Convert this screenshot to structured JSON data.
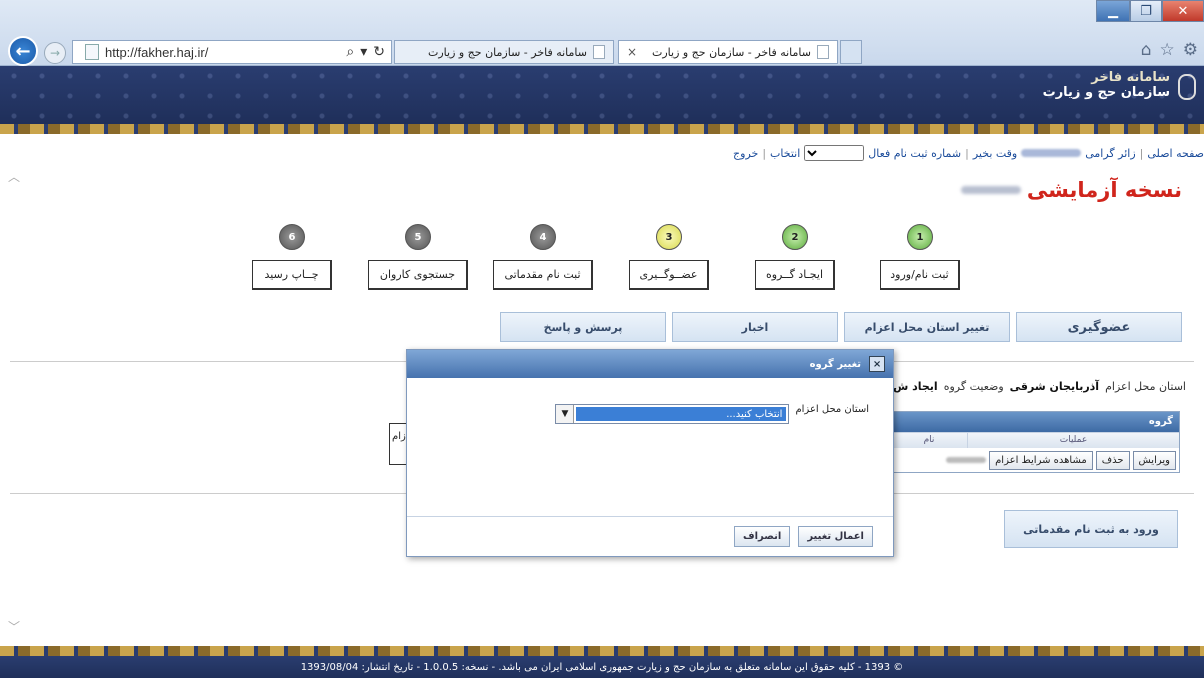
{
  "browser": {
    "url": "http://fakher.haj.ir/",
    "tabs": [
      {
        "label": "سامانه فاخر - سازمان حج و زیارت"
      },
      {
        "label": "سامانه فاخر - سازمان حج و زیارت"
      }
    ],
    "tab_close": "×"
  },
  "logo": {
    "line1": "سامانه فاخر",
    "line2": "سازمان حج و زیارت"
  },
  "infobar": {
    "home": "صفحه اصلی",
    "greeting": "زائر گرامی",
    "greeting_end": "وقت بخیر",
    "reg_number": "شماره ثبت نام فعال",
    "select": "انتخاب",
    "logout": "خروج"
  },
  "trial_title": "نسخه آزمایشی",
  "steps": [
    {
      "num": "1",
      "label": "ثبت نام/ورود"
    },
    {
      "num": "2",
      "label": "ایجـاد گــروه"
    },
    {
      "num": "3",
      "label": "عضــوگــیری"
    },
    {
      "num": "4",
      "label": "ثبت نام مقدماتی"
    },
    {
      "num": "5",
      "label": "جستجوی کاروان"
    },
    {
      "num": "6",
      "label": "چــاپ رسید"
    }
  ],
  "menu": {
    "membership": "عضوگیری",
    "change_province": "تغییر استان محل اعزام",
    "news": "اخبار",
    "qa": "پرسش و پاسخ"
  },
  "status": {
    "province_label": "استان محل اعزام",
    "province_value": "آذربایجان شرقی",
    "group_status_label": "وضعیت گروه",
    "group_status_value": "ایجاد ش"
  },
  "grid": {
    "title": "گروه",
    "col_ops": "عملیات",
    "col_name": "نام",
    "btn_edit": "ویرایش",
    "btn_delete": "حذف",
    "btn_conditions": "مشاهده شرایط اعزام"
  },
  "behind_label": "زام",
  "prereg_button": "ورود به ثبت نام مقدماتی",
  "modal": {
    "title": "تغییر گروه",
    "close": "×",
    "field_label": "استان محل اعزام",
    "select_value": "انتخاب کنید...",
    "apply": "اعمال تغییر",
    "cancel": "انصراف"
  },
  "footer": "© 1393 - کلیه حقوق این سامانه متعلق به سازمان حج و زیارت جمهوری اسلامی ایران می باشد. - نسخه: 1.0.0.5 - تاریخ انتشار: 1393/08/04"
}
